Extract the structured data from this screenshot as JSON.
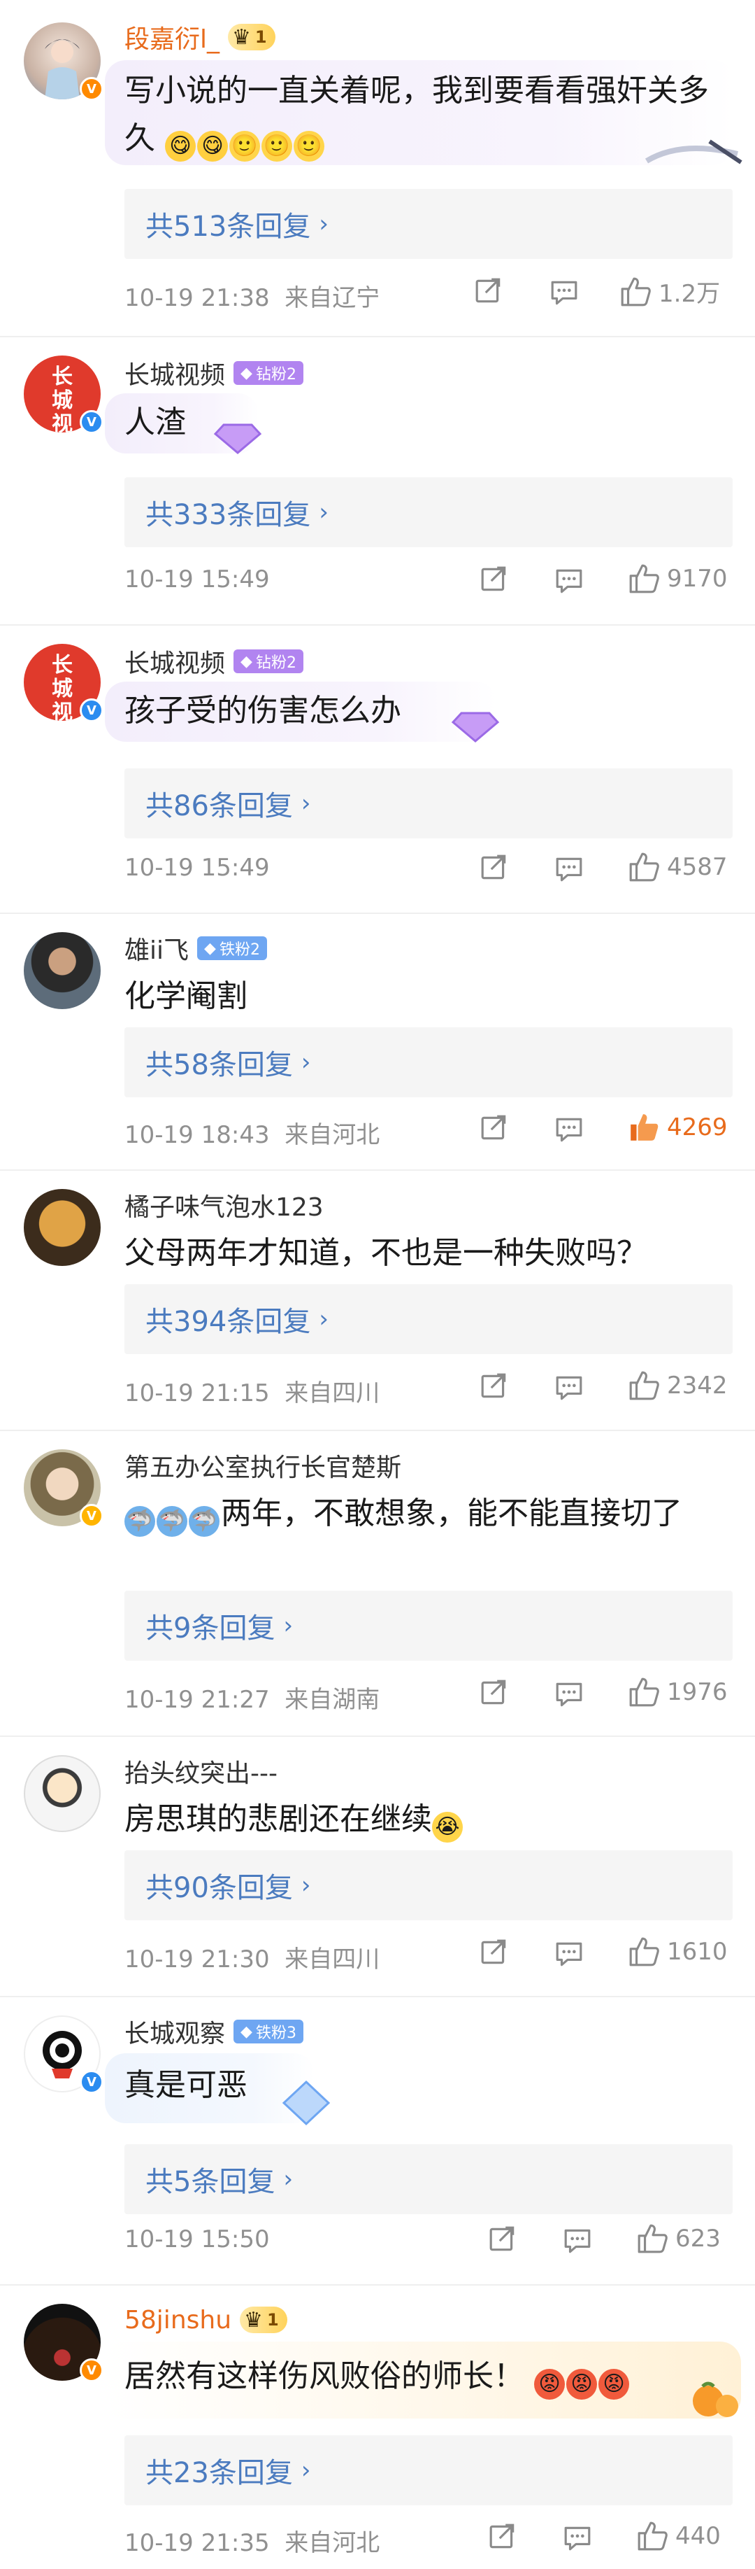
{
  "comments": [
    {
      "user": "段嘉衍l_",
      "crown_level": "1",
      "text": "写小说的一直关着呢，我到要看看强奸关多久",
      "replies": "共513条回复",
      "time": "10-19 21:38",
      "location": "来自辽宁",
      "likes": "1.2万",
      "avatar_icon": "anime-girl-avatar",
      "verified_color": "#ff8a00"
    },
    {
      "user": "长城视频",
      "fan_badge": "钻粉2",
      "avatar_text": "长 城 视 频",
      "text": "人渣",
      "replies": "共333条回复",
      "time": "10-19 15:49",
      "likes": "9170",
      "verified_color": "#2b8cf0"
    },
    {
      "user": "长城视频",
      "fan_badge": "钻粉2",
      "avatar_text": "长 城 视 频",
      "text": "孩子受的伤害怎么办",
      "replies": "共86条回复",
      "time": "10-19 15:49",
      "likes": "4587",
      "verified_color": "#2b8cf0"
    },
    {
      "user": "雄ii飞",
      "fan_badge": "铁粉2",
      "text": "化学阉割",
      "replies": "共58条回复",
      "time": "10-19 18:43",
      "location": "来自河北",
      "likes": "4269",
      "liked": true
    },
    {
      "user": "橘子味气泡水123",
      "text": "父母两年才知道，不也是一种失败吗？",
      "replies": "共394条回复",
      "time": "10-19 21:15",
      "location": "来自四川",
      "likes": "2342"
    },
    {
      "user": "第五办公室执行长官楚斯",
      "text_prefix_emojis": "shark-emoji x3",
      "text": "两年，不敢想象，能不能直接切了",
      "replies": "共9条回复",
      "time": "10-19 21:27",
      "location": "来自湖南",
      "likes": "1976",
      "verified_color": "#ffb400"
    },
    {
      "user": "抬头纹突出---",
      "text": "房思琪的悲剧还在继续",
      "replies": "共90条回复",
      "time": "10-19 21:30",
      "location": "来自四川",
      "likes": "1610"
    },
    {
      "user": "长城观察",
      "fan_badge": "铁粉3",
      "text": "真是可恶",
      "replies": "共5条回复",
      "time": "10-19 15:50",
      "likes": "623",
      "verified_color": "#2b8cf0"
    },
    {
      "user": "58jinshu",
      "crown_level": "1",
      "text": "居然有这样伤风败俗的师长！",
      "replies": "共23条回复",
      "time": "10-19 21:35",
      "location": "来自河北",
      "likes": "440",
      "verified_color": "#ff8a00"
    }
  ],
  "colors": {
    "link_blue": "#4b7bbf",
    "meta_gray": "#909090",
    "like_orange": "#e86b1c",
    "reply_bg": "#f5f5f5"
  }
}
